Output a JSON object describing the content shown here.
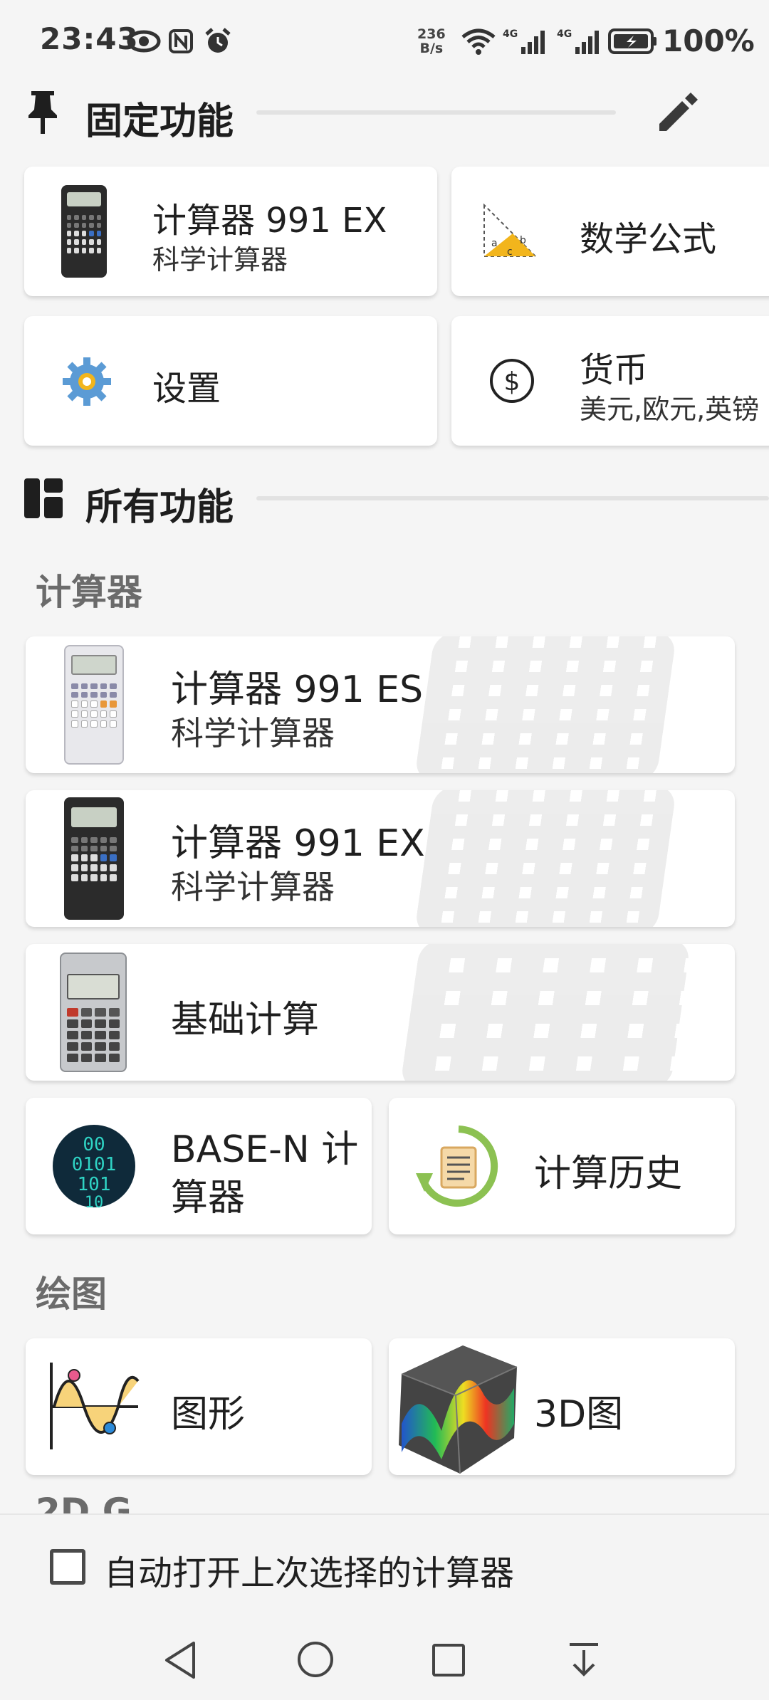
{
  "status_bar": {
    "time": "23:43",
    "net_speed_value": "236",
    "net_speed_unit": "B/s",
    "battery": "100%",
    "icons": [
      "eye-icon",
      "nfc-icon",
      "alarm-icon",
      "wifi-icon",
      "signal-4g-icon",
      "signal-4g-icon",
      "battery-charging-icon"
    ]
  },
  "pinned": {
    "title": "固定功能",
    "items": [
      {
        "title": "计算器 991 EX",
        "subtitle": "科学计算器"
      },
      {
        "title": "数学公式",
        "subtitle": ""
      },
      {
        "title": "设置",
        "subtitle": ""
      },
      {
        "title": "货币",
        "subtitle": "美元,欧元,英镑"
      }
    ]
  },
  "all": {
    "title": "所有功能",
    "groups": [
      {
        "label": "计算器",
        "items": [
          {
            "title": "计算器 991 ES",
            "subtitle": "科学计算器"
          },
          {
            "title": "计算器 991 EX",
            "subtitle": "科学计算器"
          },
          {
            "title": "基础计算",
            "subtitle": ""
          },
          {
            "title": "BASE-N 计",
            "title2": "算器"
          },
          {
            "title": "计算历史"
          }
        ]
      },
      {
        "label": "绘图",
        "items": [
          {
            "title": "图形"
          },
          {
            "title": "3D图"
          }
        ]
      }
    ],
    "next_group_partial": "2D G.."
  },
  "footer": {
    "checkbox_label": "自动打开上次选择的计算器",
    "checkbox_checked": false
  },
  "nav": {
    "icons": [
      "back-icon",
      "home-icon",
      "recents-icon",
      "collapse-icon"
    ]
  },
  "colors": {
    "background": "#f5f5f5",
    "card": "#ffffff",
    "group_label": "#6b6b6b"
  }
}
